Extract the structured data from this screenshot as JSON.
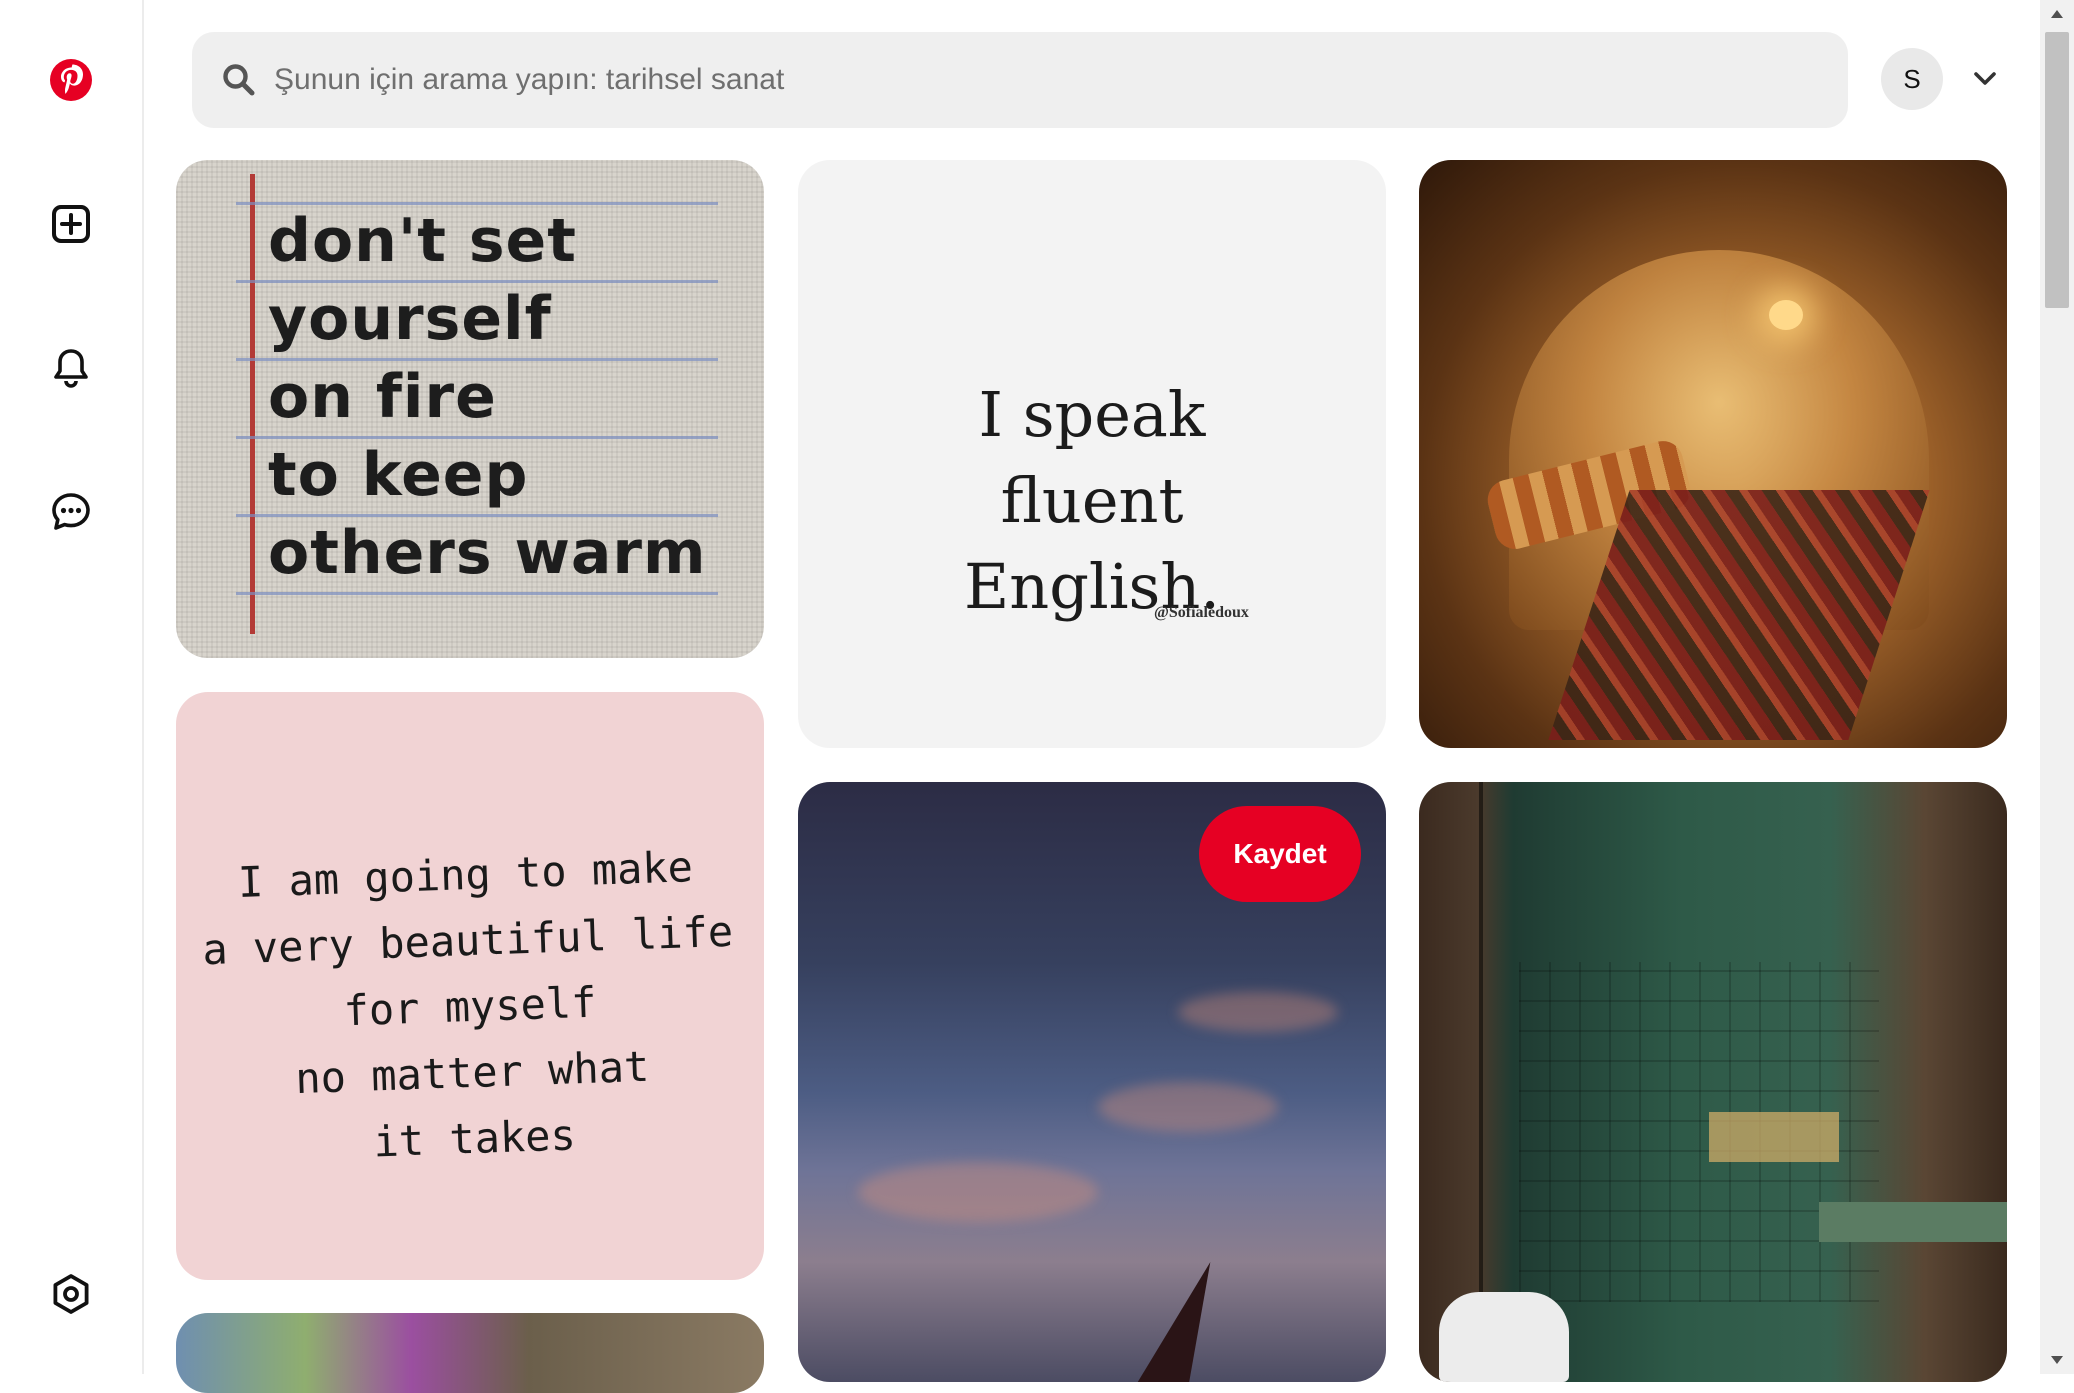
{
  "app": {
    "brand_color": "#e60023",
    "name": "Pinterest"
  },
  "sidebar": {
    "items": [
      {
        "name": "pinterest-logo",
        "icon": "pinterest-logo"
      },
      {
        "name": "create",
        "icon": "plus-square-icon"
      },
      {
        "name": "notifications",
        "icon": "bell-icon"
      },
      {
        "name": "messages",
        "icon": "chat-icon"
      },
      {
        "name": "settings",
        "icon": "settings-icon"
      }
    ]
  },
  "header": {
    "search_placeholder": "Şunun için arama yapın: tarihsel sanat",
    "search_value": "",
    "avatar_initial": "S"
  },
  "pins": {
    "p1_text": "don't set\nyourself\non fire\nto keep\nothers warm",
    "p2_quote": "I speak fluent English.",
    "p2_credit": "@Sofialedoux",
    "p4_text": "I am going to make\na very beautiful life\nfor myself\nno matter what\nit takes",
    "save_label": "Kaydet"
  }
}
